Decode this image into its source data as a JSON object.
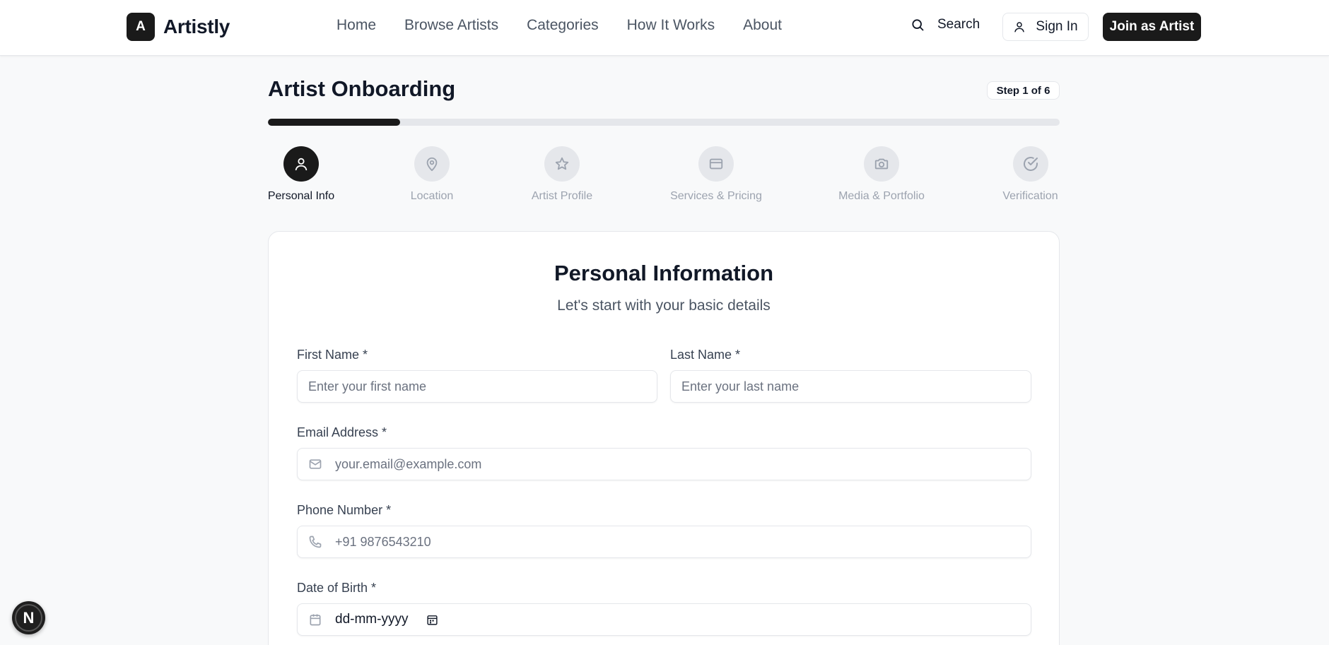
{
  "brand": {
    "mark": "A",
    "name": "Artistly"
  },
  "nav": {
    "items": [
      "Home",
      "Browse Artists",
      "Categories",
      "How It Works",
      "About"
    ]
  },
  "header": {
    "search_label": "Search",
    "signin_label": "Sign In",
    "join_label": "Join as Artist"
  },
  "page": {
    "title": "Artist Onboarding",
    "step_badge": "Step 1 of 6",
    "progress_fraction": 0.1667
  },
  "steps": [
    {
      "label": "Personal Info",
      "icon": "user-icon",
      "active": true
    },
    {
      "label": "Location",
      "icon": "map-pin-icon",
      "active": false
    },
    {
      "label": "Artist Profile",
      "icon": "star-icon",
      "active": false
    },
    {
      "label": "Services & Pricing",
      "icon": "credit-card-icon",
      "active": false
    },
    {
      "label": "Media & Portfolio",
      "icon": "camera-icon",
      "active": false
    },
    {
      "label": "Verification",
      "icon": "check-circle-icon",
      "active": false
    }
  ],
  "form": {
    "title": "Personal Information",
    "subtitle": "Let's start with your basic details",
    "first_name": {
      "label": "First Name *",
      "placeholder": "Enter your first name",
      "value": ""
    },
    "last_name": {
      "label": "Last Name *",
      "placeholder": "Enter your last name",
      "value": ""
    },
    "email": {
      "label": "Email Address *",
      "placeholder": "your.email@example.com",
      "value": ""
    },
    "phone": {
      "label": "Phone Number *",
      "placeholder": "+91 9876543210",
      "value": ""
    },
    "dob": {
      "label": "Date of Birth *",
      "display": "dd-mm-yyyy"
    }
  },
  "floating_badge": {
    "letter": "N"
  },
  "colors": {
    "primary": "#1a1a1a",
    "muted": "#9ca3af",
    "border": "#e5e7eb",
    "background": "#f8f9fa"
  }
}
